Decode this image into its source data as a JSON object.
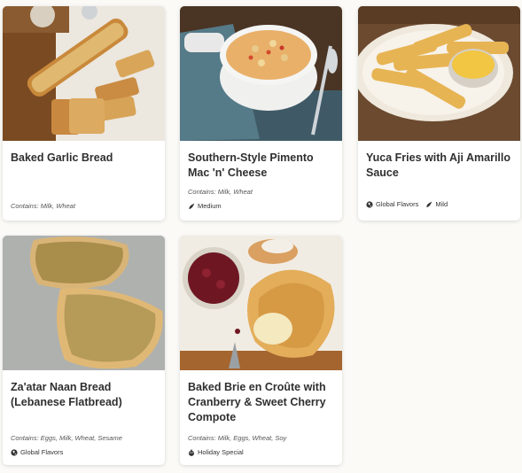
{
  "cards": [
    {
      "title": "Baked Garlic Bread",
      "contains": "Contains: Milk, Wheat",
      "tags": []
    },
    {
      "title": "Southern-Style Pimento Mac 'n' Cheese",
      "contains": "Contains: Milk, Wheat",
      "tags": [
        {
          "label": "Medium",
          "icon": "pepper-icon"
        }
      ]
    },
    {
      "title": "Yuca Fries with Aji Amarillo Sauce",
      "contains": "",
      "tags": [
        {
          "label": "Global Flavors",
          "icon": "globe-icon"
        },
        {
          "label": "Mild",
          "icon": "pepper-icon"
        }
      ]
    },
    {
      "title": "Za'atar Naan Bread (Lebanese Flatbread)",
      "contains": "Contains: Eggs, Milk, Wheat, Sesame",
      "tags": [
        {
          "label": "Global Flavors",
          "icon": "globe-icon"
        }
      ]
    },
    {
      "title": "Baked Brie en Croûte with Cranberry & Sweet Cherry Compote",
      "contains": "Contains: Milk, Eggs, Wheat, Soy",
      "tags": [
        {
          "label": "Holiday Special",
          "icon": "ornament-icon"
        }
      ]
    }
  ]
}
